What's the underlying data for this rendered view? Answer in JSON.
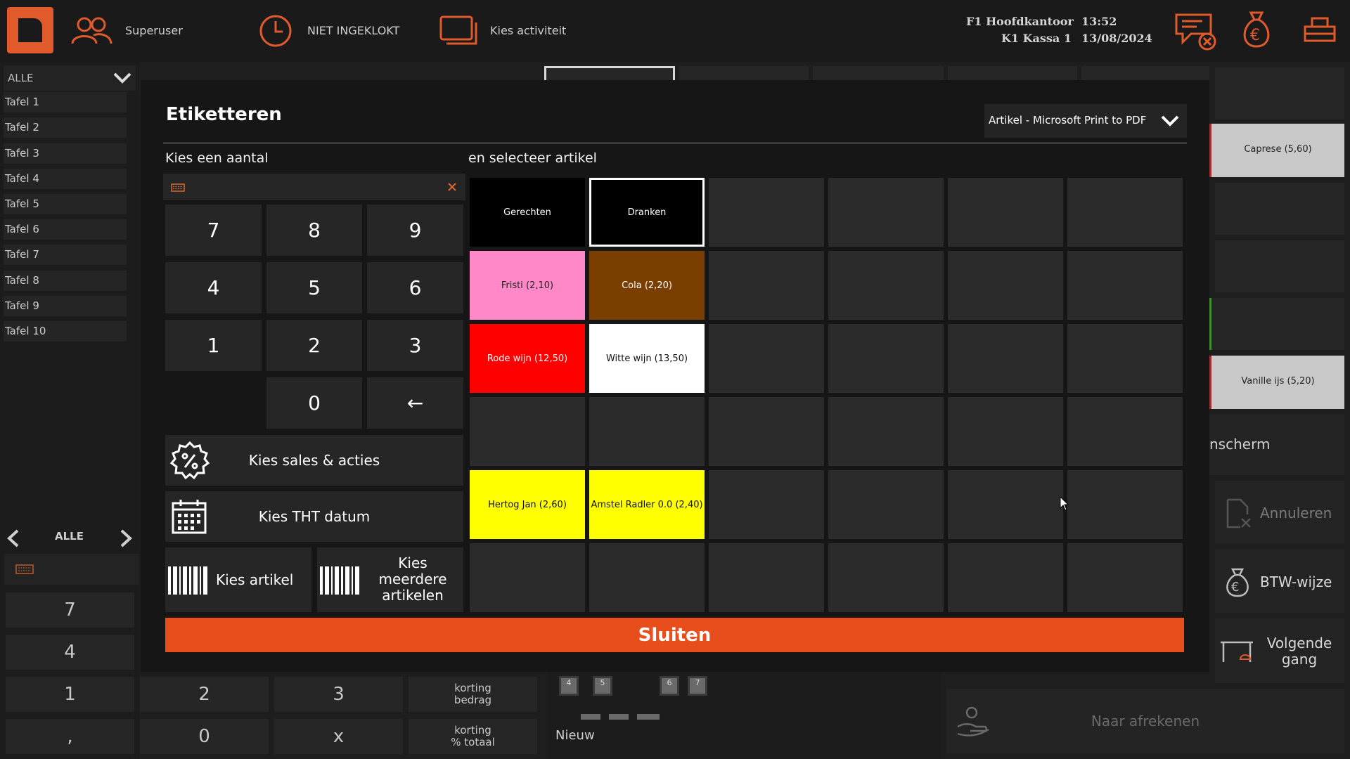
{
  "header": {
    "user": "Superuser",
    "clock_status": "NIET INGEKLOKT",
    "activity": "Kies activiteit",
    "location": "F1 Hoofdkantoor",
    "register": "K1 Kassa 1",
    "time": "13:52",
    "date": "13/08/2024"
  },
  "sidebar": {
    "filter": "ALLE",
    "tables": [
      "Tafel 1",
      "Tafel 2",
      "Tafel 3",
      "Tafel 4",
      "Tafel 5",
      "Tafel 6",
      "Tafel 7",
      "Tafel 8",
      "Tafel 9",
      "Tafel 10"
    ],
    "pager_label": "ALLE"
  },
  "bg_keypad": {
    "k7": "7",
    "k4": "4",
    "k1": "1",
    "k2": "2",
    "k3": "3",
    "korting_bedrag": "korting\nbedrag",
    "comma": ",",
    "k0": "0",
    "x": "x",
    "korting_totaal": "korting\n% totaal"
  },
  "bg_tables": {
    "t4": "4",
    "t5": "5",
    "t6": "6",
    "t7": "7",
    "new": "Nieuw"
  },
  "bg_right": {
    "item1": "Caprese (5,60)",
    "item2": "Vanille ijs (5,20)",
    "scherm": "nscherm",
    "annuleren": "Annuleren",
    "btw": "BTW-wijze",
    "volgende": "Volgende gang",
    "afrekenen": "Naar afrekenen"
  },
  "modal": {
    "title": "Etiketteren",
    "printer": "Artikel - Microsoft Print to PDF",
    "left_heading": "Kies een aantal",
    "right_heading": "en selecteer artikel",
    "keys": [
      "7",
      "8",
      "9",
      "4",
      "5",
      "6",
      "1",
      "2",
      "3",
      "0",
      "←"
    ],
    "sales_btn": "Kies sales & acties",
    "tht_btn": "Kies THT datum",
    "article_btn": "Kies artikel",
    "multi_article_btn": "Kies meerdere artikelen",
    "close_btn": "Sluiten",
    "tiles": [
      {
        "label": "Gerechten",
        "bg": "#000000",
        "fg": "#ffffff"
      },
      {
        "label": "Dranken",
        "bg": "#000000",
        "fg": "#ffffff",
        "selected": true
      },
      {
        "label": "Fristi (2,10)",
        "bg": "#ff88c8",
        "fg": "#222222"
      },
      {
        "label": "Cola (2,20)",
        "bg": "#7a3f00",
        "fg": "#ffffff"
      },
      {
        "label": "Rode wijn (12,50)",
        "bg": "#ff0000",
        "fg": "#ffffff"
      },
      {
        "label": "Witte wijn (13,50)",
        "bg": "#ffffff",
        "fg": "#111111"
      },
      {
        "label": "Hertog Jan (2,60)",
        "bg": "#ffff00",
        "fg": "#111111"
      },
      {
        "label": "Amstel Radler 0.0 (2,40)",
        "bg": "#ffff00",
        "fg": "#111111"
      }
    ]
  },
  "colors": {
    "accent": "#e84d1c",
    "brand": "#e05a2b"
  }
}
